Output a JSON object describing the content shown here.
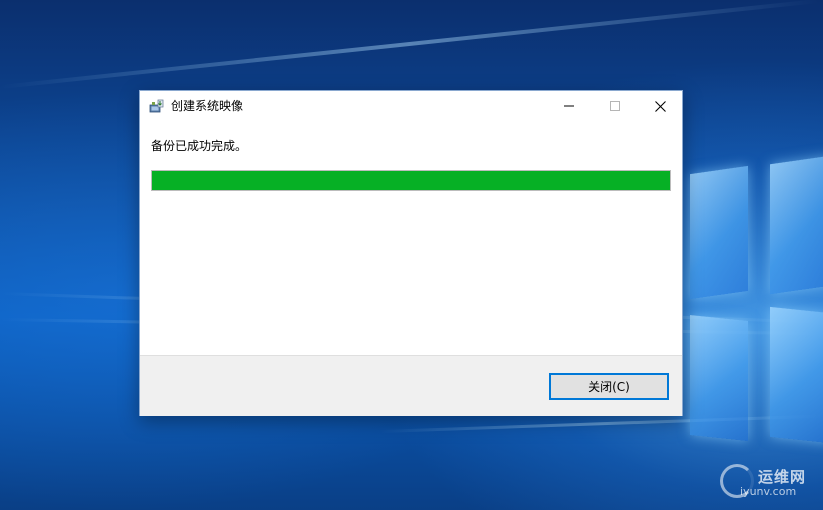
{
  "window": {
    "title": "创建系统映像",
    "app_icon": "system-image-backup-icon",
    "controls": {
      "minimize_icon": "minimize-icon",
      "maximize_icon": "maximize-icon",
      "close_icon": "close-icon"
    }
  },
  "content": {
    "message": "备份已成功完成。",
    "progress_fraction": 1.0,
    "progress_color": "#06b025"
  },
  "footer": {
    "close_button_label": "关闭(C)"
  },
  "watermark": {
    "text_cn": "运维网",
    "text_en": "iyunv.com"
  },
  "colors": {
    "accent": "#0078d7",
    "progress": "#06b025",
    "footer_bg": "#f0f0f0"
  }
}
